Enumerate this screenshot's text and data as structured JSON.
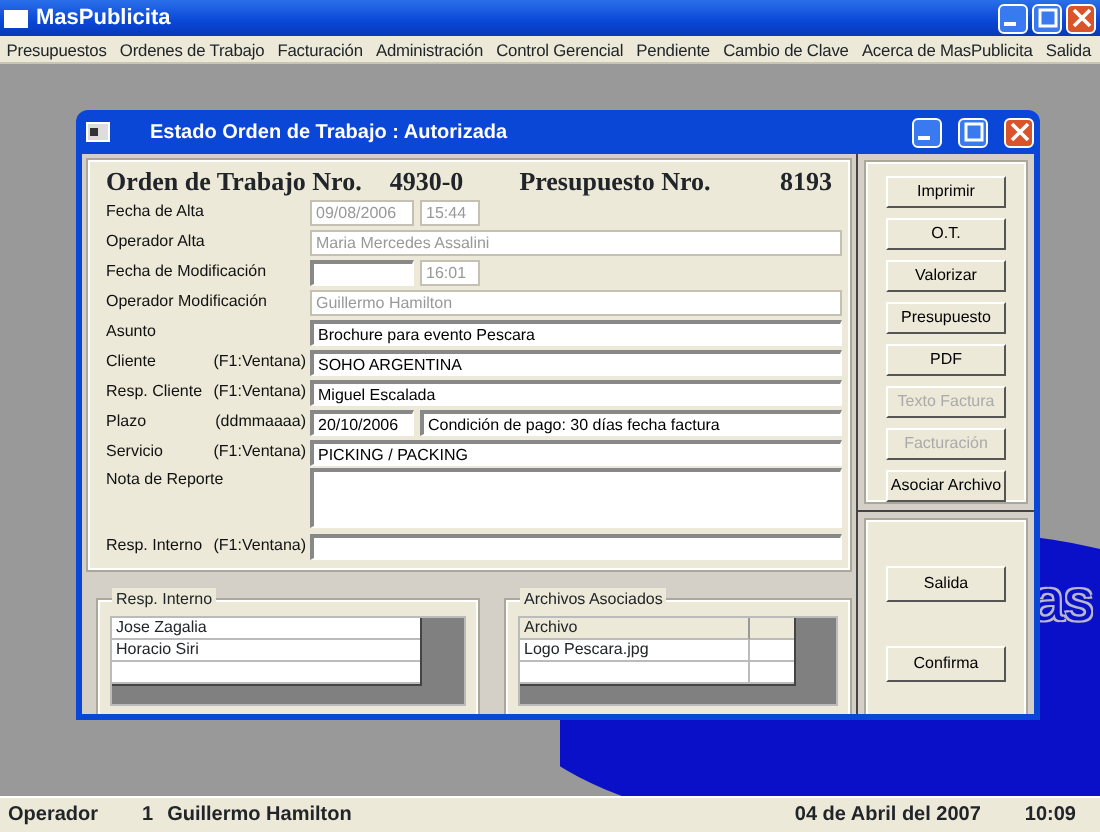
{
  "app_window": {
    "title": "MasPublicita"
  },
  "menu": [
    "Presupuestos",
    "Ordenes de Trabajo",
    "Facturación",
    "Administración",
    "Control Gerencial",
    "Pendiente",
    "Cambio de Clave",
    "Acerca de MasPublicita",
    "Salida"
  ],
  "desktop_logo": {
    "text": "as"
  },
  "dialog": {
    "title": "Estado Orden de Trabajo : Autorizada",
    "header": [
      {
        "label": "Orden de Trabajo Nro.",
        "value": "4930-0"
      },
      {
        "label": "Presupuesto Nro.",
        "value": "8193"
      }
    ],
    "fields": [
      {
        "label": "Fecha de Alta",
        "inputs": [
          {
            "kind": "date",
            "value": "09/08/2006",
            "disabled": true
          },
          {
            "kind": "time",
            "value": "15:44",
            "disabled": true
          }
        ]
      },
      {
        "label": "Operador Alta",
        "inputs": [
          {
            "kind": "fill",
            "value": "Maria Mercedes Assalini",
            "disabled": true
          }
        ]
      },
      {
        "label": "Fecha de Modificación",
        "inputs": [
          {
            "kind": "date",
            "disabled": false
          },
          {
            "kind": "time",
            "value": "16:01",
            "disabled": true
          }
        ]
      },
      {
        "label": "Operador Modificación",
        "inputs": [
          {
            "kind": "fill",
            "value": "Guillermo Hamilton",
            "disabled": true
          }
        ]
      },
      {
        "label": "Asunto",
        "inputs": [
          {
            "kind": "fill",
            "value": "Brochure para evento Pescara",
            "disabled": false
          }
        ]
      },
      {
        "label": "Cliente",
        "hint": "(F1:Ventana)",
        "inputs": [
          {
            "kind": "fill",
            "value": "SOHO ARGENTINA",
            "disabled": false
          }
        ]
      },
      {
        "label": "Resp. Cliente",
        "hint": "(F1:Ventana)",
        "inputs": [
          {
            "kind": "fill",
            "value": "Miguel Escalada",
            "disabled": false
          }
        ]
      },
      {
        "label": "Plazo",
        "hint": "(ddmmaaaa)",
        "inputs": [
          {
            "kind": "date",
            "value": "20/10/2006",
            "disabled": false
          },
          {
            "kind": "fill",
            "value": "Condición de pago: 30 días fecha factura",
            "disabled": false
          }
        ]
      },
      {
        "label": "Servicio",
        "hint": "(F1:Ventana)",
        "inputs": [
          {
            "kind": "fill",
            "value": "PICKING / PACKING",
            "disabled": false
          }
        ]
      },
      {
        "label": "Nota de Reporte",
        "inputs": [
          {
            "kind": "tall",
            "disabled": false
          }
        ]
      },
      {
        "label": "Resp. Interno",
        "hint": "(F1:Ventana)",
        "inputs": [
          {
            "kind": "fill",
            "disabled": false
          }
        ]
      }
    ],
    "resp_interno": {
      "title": "Resp. Interno",
      "rows": [
        "Jose Zagalia",
        "Horacio Siri"
      ]
    },
    "archivos": {
      "title": "Archivos Asociados",
      "columns": [
        "Archivo"
      ],
      "rows": [
        "Logo Pescara.jpg"
      ]
    },
    "buttons": [
      {
        "label": "Imprimir",
        "disabled": false
      },
      {
        "label": "O.T.",
        "disabled": false
      },
      {
        "label": "Valorizar",
        "disabled": false
      },
      {
        "label": "Presupuesto",
        "disabled": false
      },
      {
        "label": "PDF",
        "disabled": false
      },
      {
        "label": "Texto Factura",
        "disabled": true
      },
      {
        "label": "Facturación",
        "disabled": true
      },
      {
        "label": "Asociar Archivo",
        "disabled": false
      }
    ],
    "bottom_buttons": [
      {
        "label": "Salida",
        "disabled": false
      },
      {
        "label": "Confirma",
        "disabled": false
      }
    ]
  },
  "status_bar": {
    "operator_label": "Operador",
    "operator_id": "1",
    "operator_name": "Guillermo Hamilton",
    "date": "04 de Abril del 2007",
    "time": "10:09"
  }
}
